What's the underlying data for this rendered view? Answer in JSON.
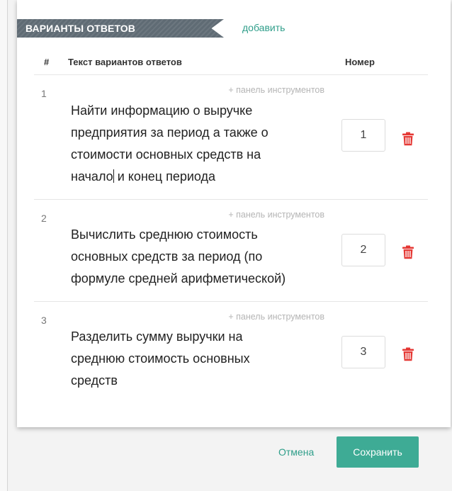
{
  "section": {
    "title": "ВАРИАНТЫ ОТВЕТОВ",
    "add_label": "добавить"
  },
  "table": {
    "headers": {
      "index": "#",
      "text": "Текст вариантов ответов",
      "number": "Номер"
    },
    "rows": [
      {
        "index": "1",
        "toolbar_label": "+ панель инструментов",
        "lines": [
          "Найти информацию о выручке",
          "предприятия за период а также о",
          "стоимости основных средств на",
          "начало",
          "и конец периода"
        ],
        "number": "1"
      },
      {
        "index": "2",
        "toolbar_label": "+ панель инструментов",
        "lines": [
          "Вычислить среднюю стоимость",
          "основных средств за период (по",
          "формуле средней арифметической)"
        ],
        "number": "2"
      },
      {
        "index": "3",
        "toolbar_label": "+ панель инструментов",
        "lines": [
          "Разделить сумму выручки на",
          "среднюю стоимость основных",
          "средств"
        ],
        "number": "3"
      }
    ]
  },
  "footer": {
    "cancel_label": "Отмена",
    "save_label": "Сохранить"
  },
  "icons": {
    "delete": "trash-icon"
  },
  "colors": {
    "accent": "#3eab95",
    "link": "#2f9e8a",
    "delete": "#e53935",
    "header_bg": "#5f6b74"
  }
}
